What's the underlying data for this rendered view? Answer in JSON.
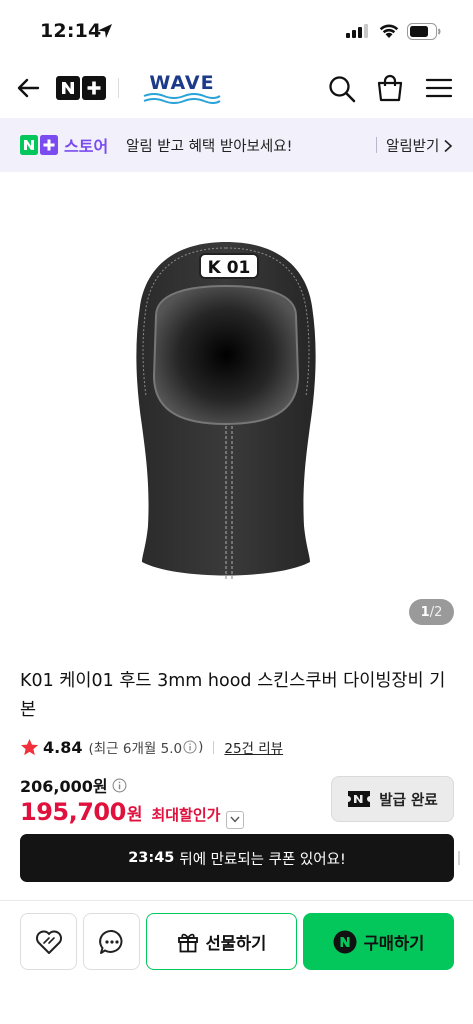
{
  "status_bar": {
    "time": "12:14"
  },
  "nav": {
    "brand_text": "WAVE",
    "icons": [
      "back-arrow-icon",
      "nplus-logo",
      "brand-logo",
      "search-icon",
      "shopping-bag-icon",
      "hamburger-menu-icon"
    ]
  },
  "promo": {
    "store_name": "스토어",
    "message": "알림 받고 혜택 받아보세요!",
    "action_label": "알림받기"
  },
  "gallery": {
    "current_page": "1",
    "total_pages": "/2"
  },
  "product": {
    "title": "K01 케이01 후드 3mm hood 스킨스쿠버 다이빙장비 기본",
    "rating": {
      "score": "4.84",
      "recent_prefix": "(최근 6개월 5.0",
      "recent_suffix": ")",
      "review_count": "25건 리뷰"
    },
    "original_price": "206,000원",
    "sale_price": "195,700",
    "sale_unit": "원",
    "max_discount_label": "최대할인가"
  },
  "coupon": {
    "label": "발급 완료"
  },
  "timer": {
    "time": "23:45",
    "message": "뒤에 만료되는 쿠폰 있어요!"
  },
  "actions": {
    "gift_label": "선물하기",
    "buy_label": "구매하기"
  },
  "colors": {
    "naver_green": "#03c75a",
    "price_red": "#e0113d",
    "promo_bg": "#f1f0fb",
    "store_purple": "#7a4cf0"
  }
}
